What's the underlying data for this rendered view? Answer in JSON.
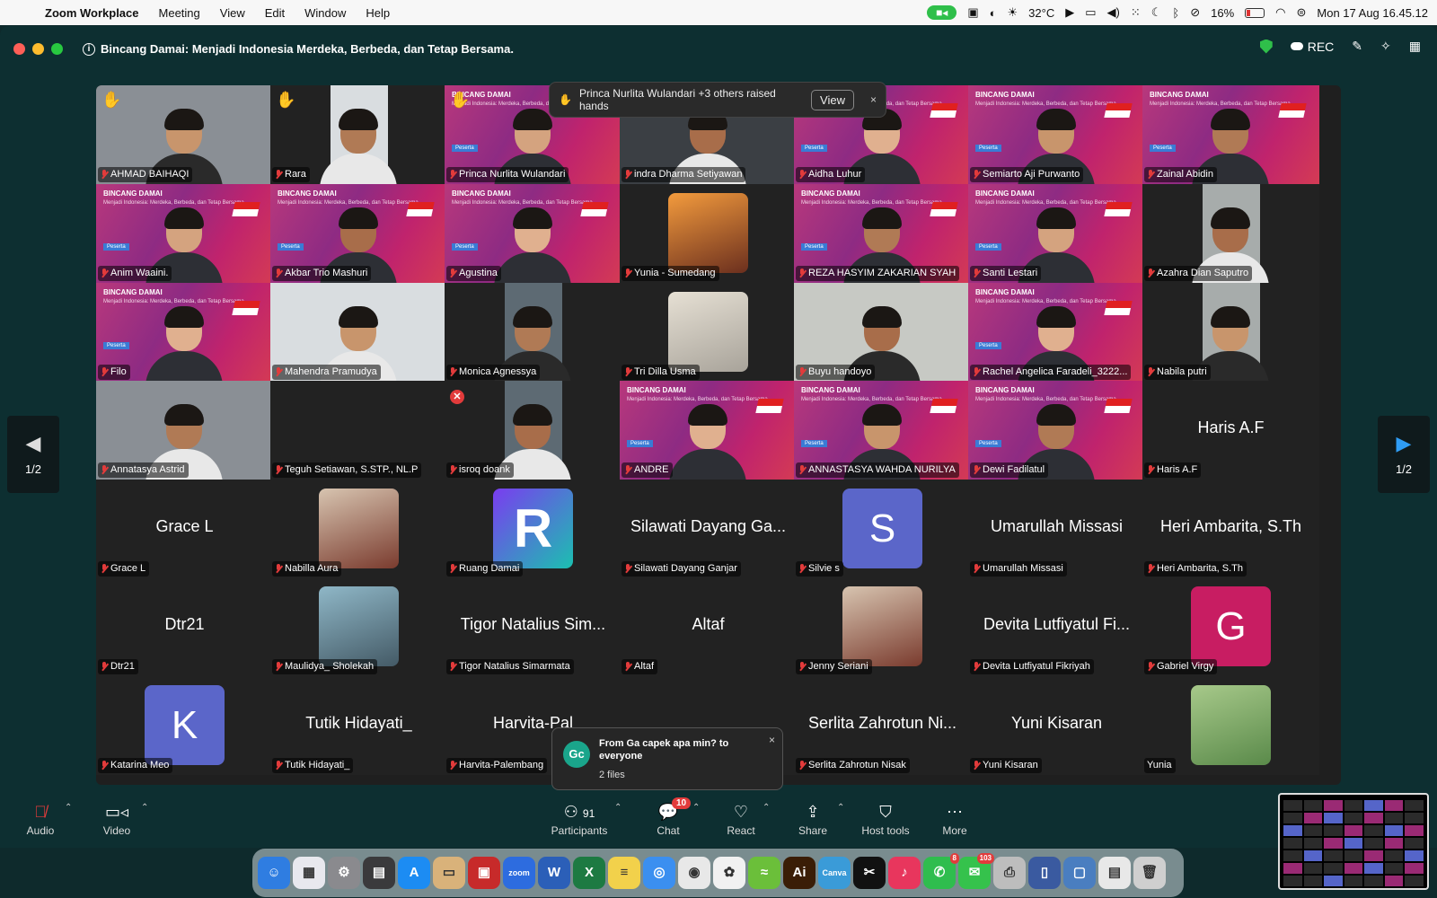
{
  "menubar": {
    "app": "Zoom Workplace",
    "items": [
      "Meeting",
      "View",
      "Edit",
      "Window",
      "Help"
    ],
    "temperature": "32°C",
    "battery": "16%",
    "datetime": "Mon 17 Aug  16.45.12"
  },
  "window": {
    "title": "Bincang Damai: Menjadi Indonesia Merdeka, Berbeda, dan Tetap Bersama.",
    "rec_label": "REC"
  },
  "banner": {
    "title": "BINCANG DAMAI",
    "subtitle": "Menjadi Indonesia: Merdeka, Berbeda, dan Tetap Bersama",
    "tag": "Peserta"
  },
  "notification": {
    "text": "Princa Nurlita Wulandari +3 others raised hands",
    "view_label": "View",
    "close": "×"
  },
  "pager": {
    "left": "1/2",
    "right": "1/2"
  },
  "tiles": [
    {
      "name": "AHMAD BAIHAQI",
      "kind": "cam",
      "hand": true
    },
    {
      "name": "Rara",
      "kind": "cam",
      "hand": true
    },
    {
      "name": "Princa Nurlita Wulandari",
      "kind": "banner",
      "hand": true
    },
    {
      "name": "indra Dharma Setiyawan",
      "kind": "cam"
    },
    {
      "name": "Aidha Luhur",
      "kind": "banner"
    },
    {
      "name": "Semiarto Aji Purwanto",
      "kind": "banner"
    },
    {
      "name": "Zainal Abidin",
      "kind": "banner"
    },
    {
      "name": "Anim Waaini.",
      "kind": "banner"
    },
    {
      "name": "Akbar Trio Mashuri",
      "kind": "banner",
      "active": true
    },
    {
      "name": "Agustina",
      "kind": "banner"
    },
    {
      "name": "Yunia - Sumedang",
      "kind": "photo"
    },
    {
      "name": "REZA HASYIM ZAKARIAN SYAH",
      "kind": "banner"
    },
    {
      "name": "Santi Lestari",
      "kind": "banner"
    },
    {
      "name": "Azahra Dian Saputro",
      "kind": "cam"
    },
    {
      "name": "Filo",
      "kind": "banner"
    },
    {
      "name": "Mahendra Pramudya",
      "kind": "cam"
    },
    {
      "name": "Monica Agnessya",
      "kind": "cam"
    },
    {
      "name": "Tri Dilla Usma",
      "kind": "photo"
    },
    {
      "name": "Buyu handoyo",
      "kind": "cam"
    },
    {
      "name": "Rachel Angelica Faradeli_3222...",
      "kind": "banner"
    },
    {
      "name": "Nabila putri",
      "kind": "cam"
    },
    {
      "name": "Annatasya Astrid",
      "kind": "cam"
    },
    {
      "name": "Teguh Setiawan, S.STP., NL.P",
      "kind": "dark"
    },
    {
      "name": "isroq doank",
      "kind": "cam",
      "error": true
    },
    {
      "name": "ANDRE",
      "kind": "banner"
    },
    {
      "name": "ANNASTASYA WAHDA NURILYA",
      "kind": "banner"
    },
    {
      "name": "Dewi Fadilatul",
      "kind": "banner"
    },
    {
      "name": "Haris A.F",
      "kind": "text",
      "big": "Haris A.F"
    },
    {
      "name": "Grace L",
      "kind": "text",
      "big": "Grace L"
    },
    {
      "name": "Nabilla Aura",
      "kind": "photo"
    },
    {
      "name": "Ruang Damai",
      "kind": "logo"
    },
    {
      "name": "Silawati Dayang Ganjar",
      "kind": "text",
      "big": "Silawati Dayang Ga..."
    },
    {
      "name": "Silvie s",
      "kind": "avatar",
      "letter": "S",
      "color": "#5b66c9"
    },
    {
      "name": "Umarullah Missasi",
      "kind": "text",
      "big": "Umarullah Missasi"
    },
    {
      "name": "Heri Ambarita, S.Th",
      "kind": "text",
      "big": "Heri Ambarita, S.Th"
    },
    {
      "name": "Dtr21",
      "kind": "text",
      "big": "Dtr21"
    },
    {
      "name": "Maulidya_ Sholekah",
      "kind": "photo"
    },
    {
      "name": "Tigor Natalius Simarmata",
      "kind": "text",
      "big": "Tigor Natalius Sim..."
    },
    {
      "name": "Altaf",
      "kind": "text",
      "big": "Altaf"
    },
    {
      "name": "Jenny Seriani",
      "kind": "photo"
    },
    {
      "name": "Devita Lutfiyatul Fikriyah",
      "kind": "text",
      "big": "Devita Lutfiyatul Fi..."
    },
    {
      "name": "Gabriel Virgy",
      "kind": "avatar",
      "letter": "G",
      "color": "#c81d62"
    },
    {
      "name": "Katarina Meo",
      "kind": "avatar",
      "letter": "K",
      "color": "#5b66c9"
    },
    {
      "name": "Tutik Hidayati_",
      "kind": "text",
      "big": "Tutik Hidayati_"
    },
    {
      "name": "Harvita-Palembang",
      "kind": "text",
      "big": "Harvita-Pal"
    },
    {
      "name": "",
      "kind": "empty"
    },
    {
      "name": "Serlita Zahrotun Nisak",
      "kind": "text",
      "big": "Serlita Zahrotun Ni..."
    },
    {
      "name": "Yuni Kisaran",
      "kind": "text",
      "big": "Yuni Kisaran"
    },
    {
      "name": "Yunia",
      "kind": "photo",
      "nomic": true
    }
  ],
  "chat_popup": {
    "avatar": "Gc",
    "message": "From Ga capek apa min? to everyone",
    "files": "2 files",
    "close": "×"
  },
  "controls": {
    "audio": "Audio",
    "video": "Video",
    "participants": "Participants",
    "participants_count": "91",
    "chat": "Chat",
    "chat_badge": "10",
    "react": "React",
    "share": "Share",
    "host_tools": "Host tools",
    "more": "More"
  },
  "dock": [
    {
      "name": "finder",
      "color": "#2f7de1",
      "label": "☺"
    },
    {
      "name": "launchpad",
      "color": "#e8e8ee",
      "label": "▦"
    },
    {
      "name": "settings",
      "color": "#8a8a8e",
      "label": "⚙"
    },
    {
      "name": "calculator",
      "color": "#3a3a3c",
      "label": "▤"
    },
    {
      "name": "appstore",
      "color": "#1c8cf3",
      "label": "A"
    },
    {
      "name": "preview",
      "color": "#d9b27a",
      "label": "▭"
    },
    {
      "name": "photobooth",
      "color": "#c72a2a",
      "label": "▣"
    },
    {
      "name": "zoom",
      "color": "#2d6cdf",
      "label": "zoom"
    },
    {
      "name": "word",
      "color": "#2b5fb8",
      "label": "W"
    },
    {
      "name": "excel",
      "color": "#1d7a42",
      "label": "X"
    },
    {
      "name": "notes",
      "color": "#f2d14b",
      "label": "≡"
    },
    {
      "name": "safari",
      "color": "#3b8ff0",
      "label": "◎"
    },
    {
      "name": "chrome",
      "color": "#e8e8e8",
      "label": "◉"
    },
    {
      "name": "photos",
      "color": "#f1f1f1",
      "label": "✿"
    },
    {
      "name": "green-app",
      "color": "#6bbf3a",
      "label": "≈"
    },
    {
      "name": "illustrator",
      "color": "#3a1d06",
      "label": "Ai"
    },
    {
      "name": "canva",
      "color": "#3a9bd8",
      "label": "Canva"
    },
    {
      "name": "capcut",
      "color": "#111",
      "label": "✂"
    },
    {
      "name": "music",
      "color": "#e8365d",
      "label": "♪"
    },
    {
      "name": "whatsapp",
      "color": "#2fbd4e",
      "label": "✆",
      "badge": "8"
    },
    {
      "name": "messages",
      "color": "#35c24c",
      "label": "✉",
      "badge": "103"
    },
    {
      "name": "printer",
      "color": "#bdbdbd",
      "label": "⎙"
    },
    {
      "name": "iphone-mirror",
      "color": "#3a5aa0",
      "label": "▯"
    },
    {
      "name": "screen-app",
      "color": "#4a7ec0",
      "label": "▢"
    },
    {
      "name": "recent-doc",
      "color": "#e8e8e8",
      "label": "▤"
    },
    {
      "name": "trash",
      "color": "#cfcfcf",
      "label": "🗑"
    }
  ]
}
